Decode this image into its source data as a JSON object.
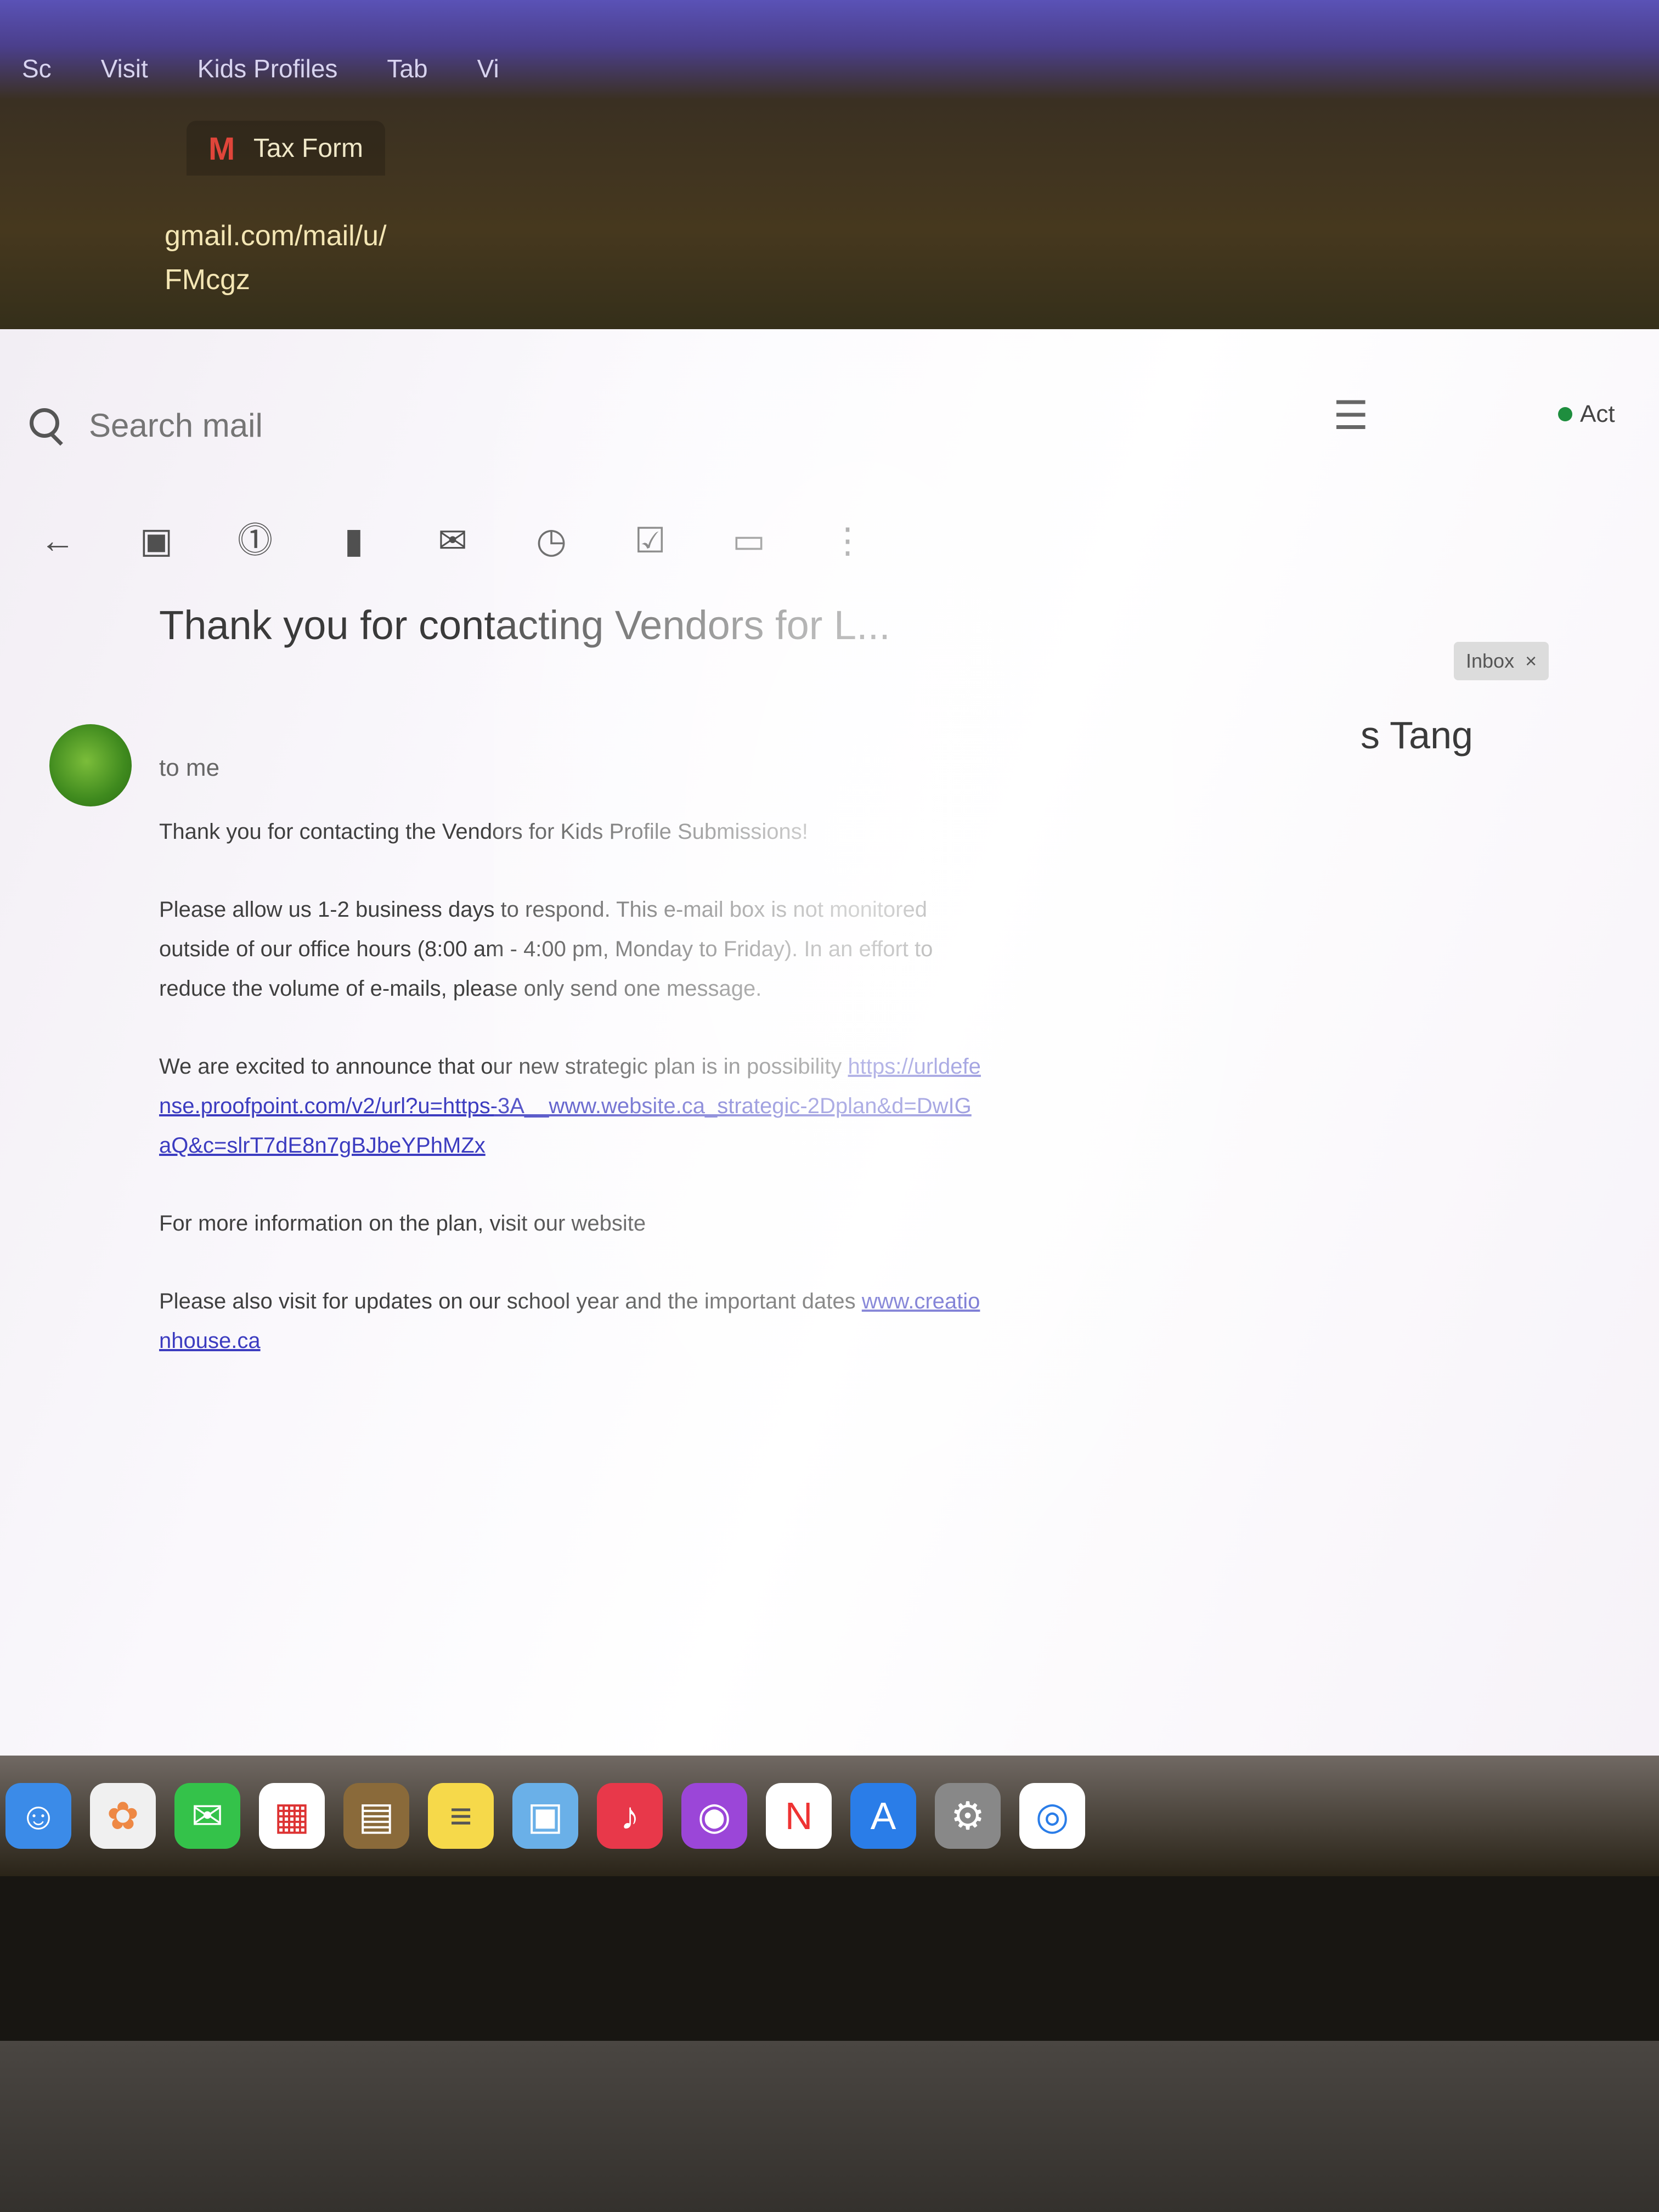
{
  "browser": {
    "bookmarks": [
      "Sc",
      "Visit",
      "Kids Profiles",
      "Tab",
      "Vi"
    ],
    "tab_title": "Tax Form",
    "email_preview_lines": [
      "gmail.com/mail/u/",
      "FMcgz"
    ]
  },
  "gmail": {
    "search_placeholder": "Search mail",
    "status": "Act",
    "toolbar_icons": [
      "back-arrow-icon",
      "archive-icon",
      "report-spam-icon",
      "delete-icon",
      "mark-unread-icon",
      "snooze-icon",
      "add-task-icon",
      "move-to-icon",
      "more-icon"
    ],
    "subject": "Thank you for contacting Vendors for L...",
    "label": "Inbox",
    "sender_to": "to me",
    "sender_right": "s Tang",
    "header_right": "…ne Tang",
    "body": {
      "p1": "Please allow us 1-2 business days to respond. This e-mail box is not monitored outside of our office hours (8:00 am - 4:00 pm, Monday to Friday). In an effort to reduce the volume of e-mails, please only send one message.",
      "p2_intro": "Thank you for contacting the Vendors for Kids Profile Submissions!",
      "p3": "We are excited to announce that our new strategic plan is in possibility",
      "p3_link": "https://urldefense.proofpoint.com/v2/url?u=https-3A__www.website.ca_strategic-2Dplan&d=DwIGaQ&c=slrT7dE8n7gBJbeYPhMZx",
      "p4": "For more information on the plan, visit our website",
      "p5": "Please also visit for updates on our school year and the important dates",
      "p5_link": "www.creationhouse.ca"
    }
  },
  "dock": {
    "apps": [
      "Finder",
      "Photos",
      "Messages",
      "Calendar",
      "Files",
      "Notes",
      "Preview",
      "Music",
      "Podcasts",
      "News",
      "App Store",
      "Settings",
      "Chrome"
    ]
  },
  "colors": {
    "accent_link": "#3c3cc0",
    "gmail_red": "#e0453a",
    "status_green": "#1e8e3e"
  }
}
